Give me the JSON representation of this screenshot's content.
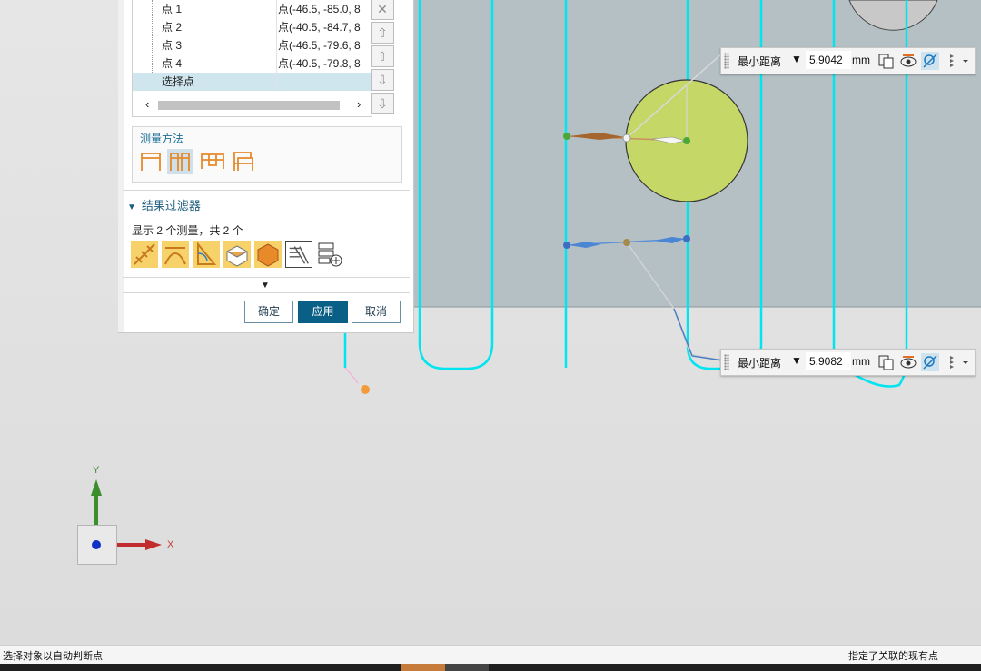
{
  "points": {
    "rows": [
      {
        "name": "点 1",
        "value": "点(-46.5, -85.0, 8"
      },
      {
        "name": "点 2",
        "value": "点(-40.5, -84.7, 8"
      },
      {
        "name": "点 3",
        "value": "点(-46.5, -79.6, 8"
      },
      {
        "name": "点 4",
        "value": "点(-40.5, -79.8, 8"
      },
      {
        "name": "选择点",
        "value": ""
      }
    ],
    "scroll_left": "‹",
    "scroll_right": "›"
  },
  "side_buttons": {
    "remove": "✕",
    "move_top": "⇧",
    "move_up": "⇧",
    "move_down": "⇩",
    "move_bottom": "⇩"
  },
  "measure_method": {
    "title": "测量方法",
    "selected_index": 1
  },
  "result_filter": {
    "title": "结果过滤器",
    "expand_glyph": "▼",
    "summary": "显示 2 个测量，共 2 个"
  },
  "more_glyph": "▼",
  "buttons": {
    "ok": "确定",
    "apply": "应用",
    "cancel": "取消"
  },
  "labels": [
    {
      "type": "最小距离",
      "arrow": "▼",
      "value": "5.9042",
      "unit": "mm"
    },
    {
      "type": "最小距离",
      "arrow": "▼",
      "value": "5.9082",
      "unit": "mm"
    }
  ],
  "triad": {
    "y": "Y",
    "x": "X"
  },
  "status": {
    "left": "选择对象以自动判断点",
    "right": "指定了关联的现有点"
  },
  "colors": {
    "accent": "#0a5f86",
    "curve": "#00e5f0",
    "circle_fill": "#c5d867",
    "part_surface": "#b4c0c4"
  }
}
